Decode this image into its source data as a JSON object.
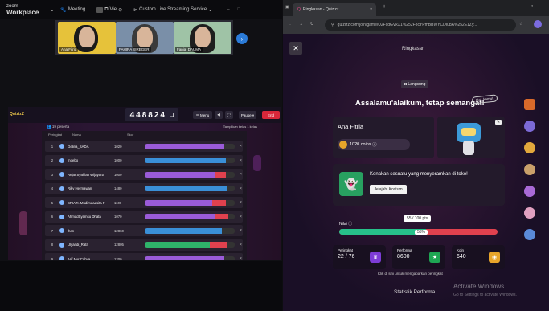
{
  "zoom": {
    "logo_top": "zoom",
    "logo_bottom": "Workplace",
    "meeting_label": "Meeting",
    "view_label": "Vie",
    "share_label": "Custom Live Streaming Service",
    "participants": [
      {
        "name": "Ana Fitria"
      },
      {
        "name": "FAHIRA SIREGER"
      },
      {
        "name": "Fania_DAUMA"
      }
    ]
  },
  "quiz_host": {
    "room_code": "448824",
    "menu_label": "Menu",
    "pause_label": "Pause",
    "end_label": "End",
    "players_label": "19 peserta",
    "hide_label": "Tampilkan kelas 1 kelas",
    "columns": [
      "Peringkat",
      "Nama",
      "Skor"
    ],
    "rows": [
      {
        "rank": "1",
        "name": "Gelina_SADA",
        "score": "1020",
        "green": 0.0,
        "purple": 0.88,
        "red": 0.0,
        "blue": 0.0
      },
      {
        "rank": "2",
        "name": "moebo",
        "score": "1000",
        "green": 0.0,
        "purple": 0.0,
        "red": 0.0,
        "blue": 0.9
      },
      {
        "rank": "3",
        "name": "Rejar Syahlan Wijayana",
        "score": "1000",
        "green": 0.0,
        "purple": 0.78,
        "red": 0.12,
        "blue": 0.0
      },
      {
        "rank": "4",
        "name": "Riky Hermawan",
        "score": "1480",
        "green": 0.0,
        "purple": 0.0,
        "red": 0.0,
        "blue": 0.92
      },
      {
        "rank": "5",
        "name": "SRIATI. Mudimeadsita F",
        "score": "1100",
        "green": 0.0,
        "purple": 0.75,
        "red": 0.15,
        "blue": 0.0
      },
      {
        "rank": "6",
        "name": "AhmadSyamsu Dhafa",
        "score": "1070",
        "green": 0.0,
        "purple": 0.78,
        "red": 0.15,
        "blue": 0.0
      },
      {
        "rank": "7",
        "name": "jhen",
        "score": "12860",
        "green": 0.0,
        "purple": 0.0,
        "red": 0.0,
        "blue": 0.86
      },
      {
        "rank": "8",
        "name": "Ulyandi_Rafa",
        "score": "12805",
        "green": 0.72,
        "purple": 0.0,
        "red": 0.2,
        "blue": 0.0
      },
      {
        "rank": "9",
        "name": "Arif Nur Cahya",
        "score": "1200",
        "green": 0.0,
        "purple": 0.88,
        "red": 0.0,
        "blue": 0.0
      }
    ]
  },
  "browser": {
    "tab_title": "Ringkasan - Quizizz",
    "new_tab": "+",
    "url": "quizizz.com/join/game/U2FsdGVkX1%252F8cYPmBBWYCDIubA%252E1Zy..."
  },
  "quiz": {
    "header": "Ringkasan",
    "live_badge": "Langsung",
    "greeting": "Assalamu'alaikum, tetap semangat!",
    "bubble": "Hai, kamu!",
    "student_name": "Ana Fitria",
    "coins": "1020 coins",
    "promo_text": "Kenakan sesuatu yang menyeramkan di toko!",
    "promo_button": "Jelajahi Kostum",
    "score_label": "Nilai",
    "score_value": "55 / 100 pts",
    "score_percent": "55%",
    "score_fraction": 0.55,
    "stats": [
      {
        "label": "Peringkat",
        "value": "22 / 76",
        "color": "#7d3cd6",
        "icon": "trophy-icon",
        "glyph": "♛"
      },
      {
        "label": "Performa",
        "value": "8600",
        "color": "#1ea653",
        "icon": "star-icon",
        "glyph": "★"
      },
      {
        "label": "Koin",
        "value": "640",
        "color": "#e8a52a",
        "icon": "coin-icon",
        "glyph": "◉"
      }
    ],
    "footer_link": "Klik di sini untuk mengaparkan peringkat",
    "stats_title": "Statistik Performa"
  },
  "windows": {
    "activate_title": "Activate Windows",
    "activate_sub": "Go to Settings to activate Windows."
  }
}
